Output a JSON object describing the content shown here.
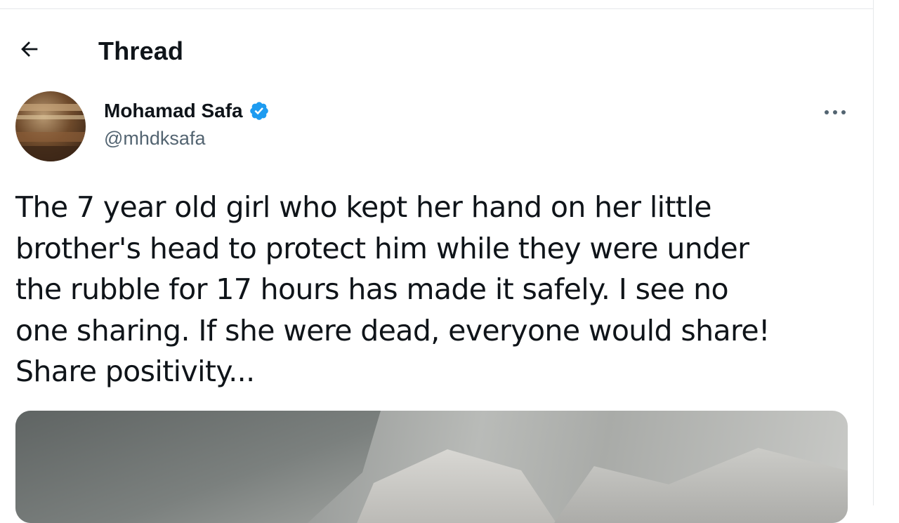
{
  "header": {
    "title": "Thread",
    "back_icon": "arrow-left-icon"
  },
  "author": {
    "display_name": "Mohamad Safa",
    "handle": "@mhdksafa",
    "verified": true,
    "verified_color": "#1d9bf0",
    "avatar_icon": "user-avatar-photo",
    "more_icon": "more-horizontal-icon"
  },
  "tweet": {
    "text": "The 7 year old girl who kept her hand on her little\nbrother's head to protect him while they were under\nthe rubble for 17 hours has made it safely. I see no\none sharing. If she were dead, everyone would share!\nShare positivity..."
  },
  "colors": {
    "text_primary": "#0f1419",
    "text_secondary": "#536471",
    "accent": "#1d9bf0"
  }
}
